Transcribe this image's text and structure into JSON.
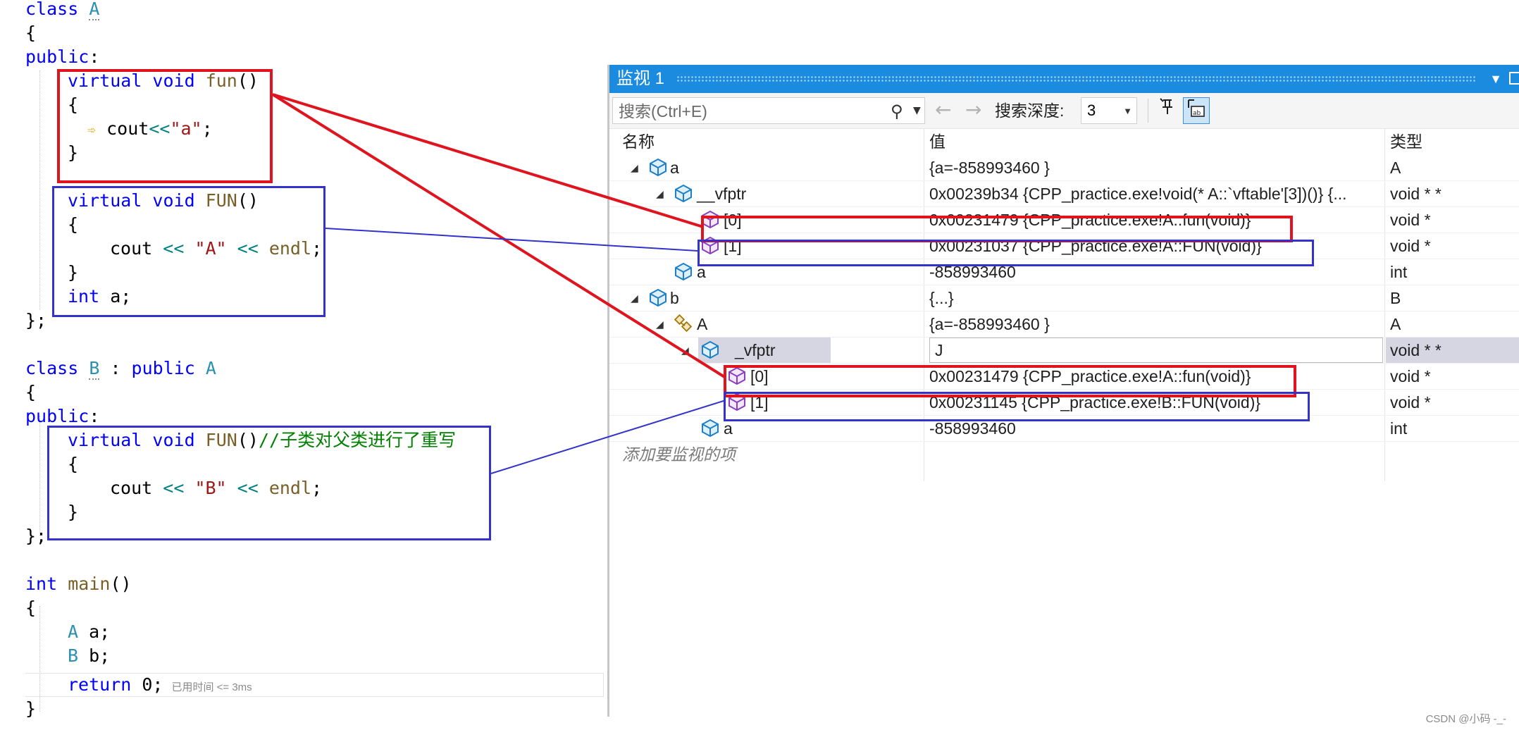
{
  "editor": {
    "lines": {
      "l1_kw": "class",
      "l1_name": "A",
      "l2": "{",
      "l3_kw": "public",
      "l3_colon": ":",
      "l4_kw1": "virtual",
      "l4_kw2": "void",
      "l4_fn": "fun",
      "l4_paren": "()",
      "l5": "{",
      "l6_cout": "cout",
      "l6_op": "<<",
      "l6_str": "\"a\"",
      "l6_end": ";",
      "l7": "}",
      "l9_kw1": "virtual",
      "l9_kw2": "void",
      "l9_fn": "FUN",
      "l9_paren": "()",
      "l10": "{",
      "l11_cout": "cout",
      "l11_op1": " << ",
      "l11_str": "\"A\"",
      "l11_op2": " << ",
      "l11_endl": "endl",
      "l11_end": ";",
      "l12": "}",
      "l13_kw": "int",
      "l13_rest": " a;",
      "l14": "};",
      "l16_kw": "class",
      "l16_name": "B",
      "l16_colon": " : ",
      "l16_kw2": "public",
      "l16_base": "A",
      "l17": "{",
      "l18_kw": "public",
      "l18_colon": ":",
      "l19_kw1": "virtual",
      "l19_kw2": "void",
      "l19_fn": "FUN",
      "l19_paren": "()",
      "l19_comment": "//子类对父类进行了重写",
      "l20": "{",
      "l21_cout": "cout",
      "l21_op1": " << ",
      "l21_str": "\"B\"",
      "l21_op2": " << ",
      "l21_endl": "endl",
      "l21_end": ";",
      "l22": "}",
      "l23": "};",
      "l25_kw": "int",
      "l25_fn": "main",
      "l25_paren": "()",
      "l26": "{",
      "l27_ty": "A",
      "l27_rest": " a;",
      "l28_ty": "B",
      "l28_rest": " b;",
      "l29_kw": "return",
      "l29_rest": " 0;",
      "l29_hint": "已用时间 <= 3ms",
      "l30": "}"
    }
  },
  "watch": {
    "title": "监视 1",
    "search_placeholder": "搜索(Ctrl+E)",
    "depth_label": "搜索深度:",
    "depth_value": "3",
    "columns": {
      "name": "名称",
      "value": "值",
      "type": "类型"
    },
    "rows": [
      {
        "name": "a",
        "value": "{a=-858993460 }",
        "type": "A"
      },
      {
        "name": "__vfptr",
        "value": "0x00239b34 {CPP_practice.exe!void(* A::`vftable'[3])()} {...",
        "type": "void * *"
      },
      {
        "name": "[0]",
        "value": "0x00231479 {CPP_practice.exe!A::fun(void)}",
        "type": "void *"
      },
      {
        "name": "[1]",
        "value": "0x00231037 {CPP_practice.exe!A::FUN(void)}",
        "type": "void *"
      },
      {
        "name": "a",
        "value": "-858993460",
        "type": "int"
      },
      {
        "name": "b",
        "value": "{...}",
        "type": "B"
      },
      {
        "name": "A",
        "value": "{a=-858993460 }",
        "type": "A"
      },
      {
        "name": "_vfptr",
        "value": "J",
        "type": "void * *"
      },
      {
        "name": "[0]",
        "value": "0x00231479 {CPP_practice.exe!A::fun(void)}",
        "type": "void *"
      },
      {
        "name": "[1]",
        "value": "0x00231145 {CPP_practice.exe!B::FUN(void)}",
        "type": "void *"
      },
      {
        "name": "a",
        "value": "-858993460",
        "type": "int"
      }
    ],
    "add_watch_hint": "添加要监视的项"
  },
  "colors": {
    "title_bar": "#1b8be0",
    "annotation_red": "#e0141e",
    "annotation_blue": "#3333cc",
    "keyword": "#0000ff",
    "type_name": "#2b91af",
    "string": "#a31515",
    "comment": "#008000"
  },
  "icons": {
    "object": "cube-icon",
    "base_class": "base-class-icon",
    "function_pointer": "cube-purple-icon",
    "search": "search-icon",
    "pin": "pin-icon"
  },
  "watermark": "CSDN @小码 -_-"
}
